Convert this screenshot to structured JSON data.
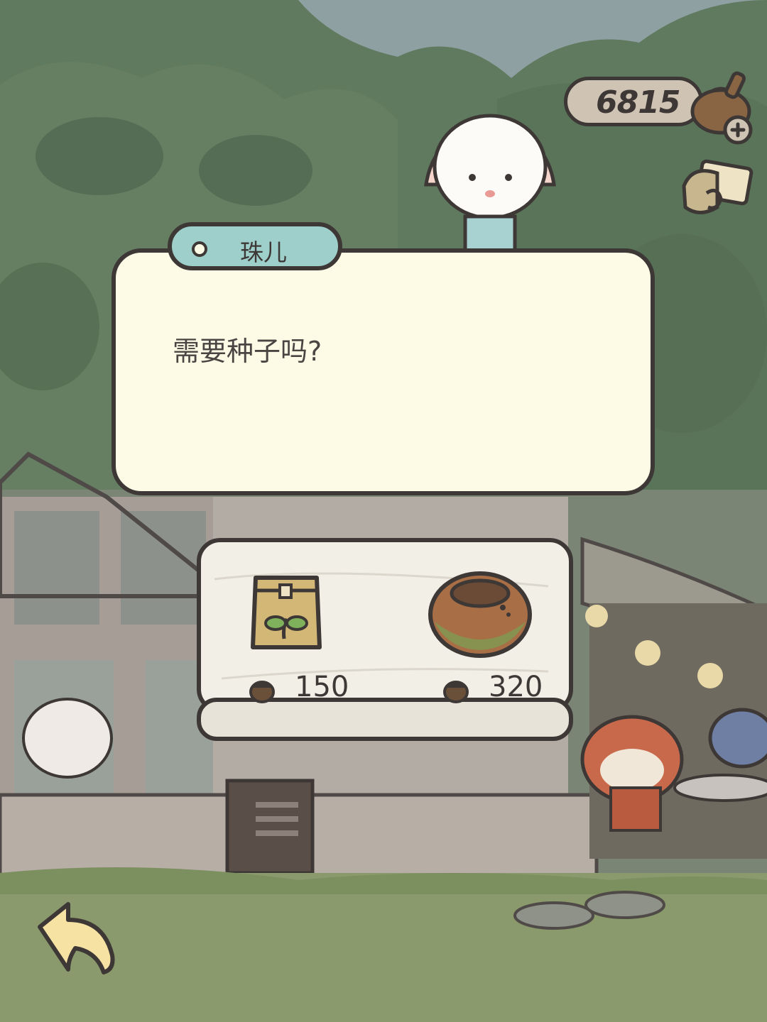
{
  "hud": {
    "currency_amount": "6815",
    "currency_icon": "acorn-icon",
    "add_icon": "plus-icon",
    "mail_icon": "mailbox-icon"
  },
  "dialog": {
    "speaker": "珠儿",
    "text": "需要种子吗?"
  },
  "shop": {
    "items": [
      {
        "icon": "seed-bag-icon",
        "price": "150"
      },
      {
        "icon": "flower-pot-icon",
        "price": "320"
      }
    ],
    "price_icon": "acorn-icon"
  },
  "navigation": {
    "back_icon": "back-arrow-icon"
  },
  "colors": {
    "outline": "#3d3836",
    "dialog_bg": "#fdfbe6",
    "nametag_bg": "#9fcfcb",
    "forest": "#5f7a5e",
    "sky": "#8fa0a3"
  }
}
